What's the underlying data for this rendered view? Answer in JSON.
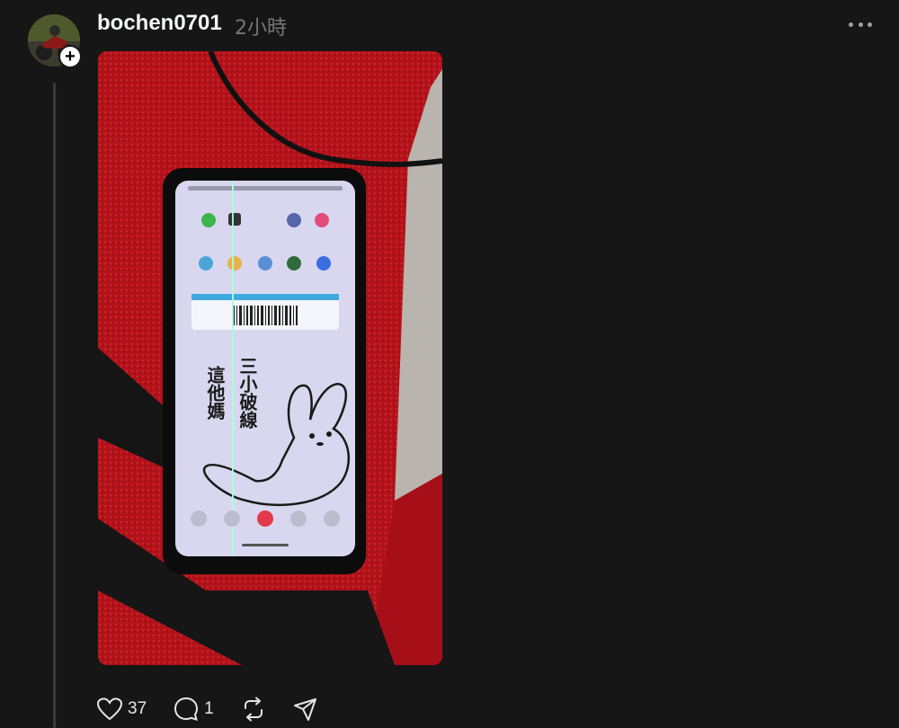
{
  "post": {
    "username": "bochen0701",
    "timestamp": "2小時",
    "follow_symbol": "+",
    "more_icon": "more-horizontal-icon"
  },
  "photo": {
    "screen_text": {
      "vertical_left": "這他媽",
      "vertical_right": "三小破線"
    }
  },
  "actions": {
    "likes": "37",
    "comments": "1",
    "icons": [
      "heart-icon",
      "comment-icon",
      "repost-icon",
      "share-icon"
    ]
  },
  "colors": {
    "background": "#161616",
    "carpet_red": "#b5121b",
    "screen": "#d9d7ef"
  }
}
